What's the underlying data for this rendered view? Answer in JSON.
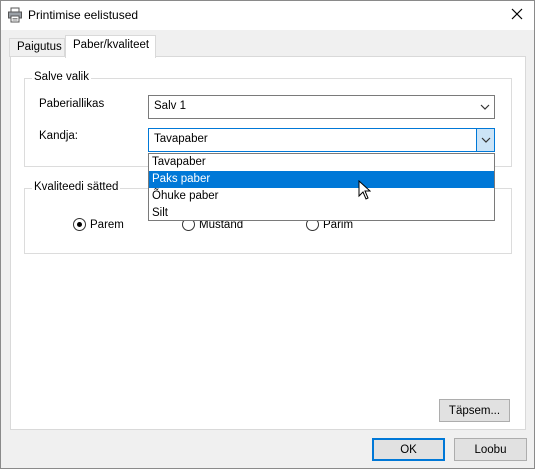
{
  "window": {
    "title": "Printimise eelistused",
    "close_label": "✕"
  },
  "tabs": [
    {
      "label": "Paigutus",
      "active": false
    },
    {
      "label": "Paber/kvaliteet",
      "active": true
    }
  ],
  "tray_group": {
    "legend": "Salve valik",
    "paper_source_label": "Paberiallikas",
    "paper_source_value": "Salv 1",
    "media_label": "Kandja:",
    "media_value": "Tavapaber",
    "media_options": [
      {
        "label": "Tavapaber",
        "highlighted": false
      },
      {
        "label": "Paks paber",
        "highlighted": true
      },
      {
        "label": "Õhuke paber",
        "highlighted": false
      },
      {
        "label": "Silt",
        "highlighted": false
      }
    ]
  },
  "quality_group": {
    "legend": "Kvaliteedi sätted",
    "options": [
      {
        "label": "Parem",
        "checked": true
      },
      {
        "label": "Mustand",
        "checked": false
      },
      {
        "label": "Parim",
        "checked": false
      }
    ]
  },
  "buttons": {
    "advanced": "Täpsem...",
    "ok": "OK",
    "cancel": "Loobu"
  },
  "colors": {
    "accent": "#0078d7",
    "selection_text": "#ffffff"
  }
}
